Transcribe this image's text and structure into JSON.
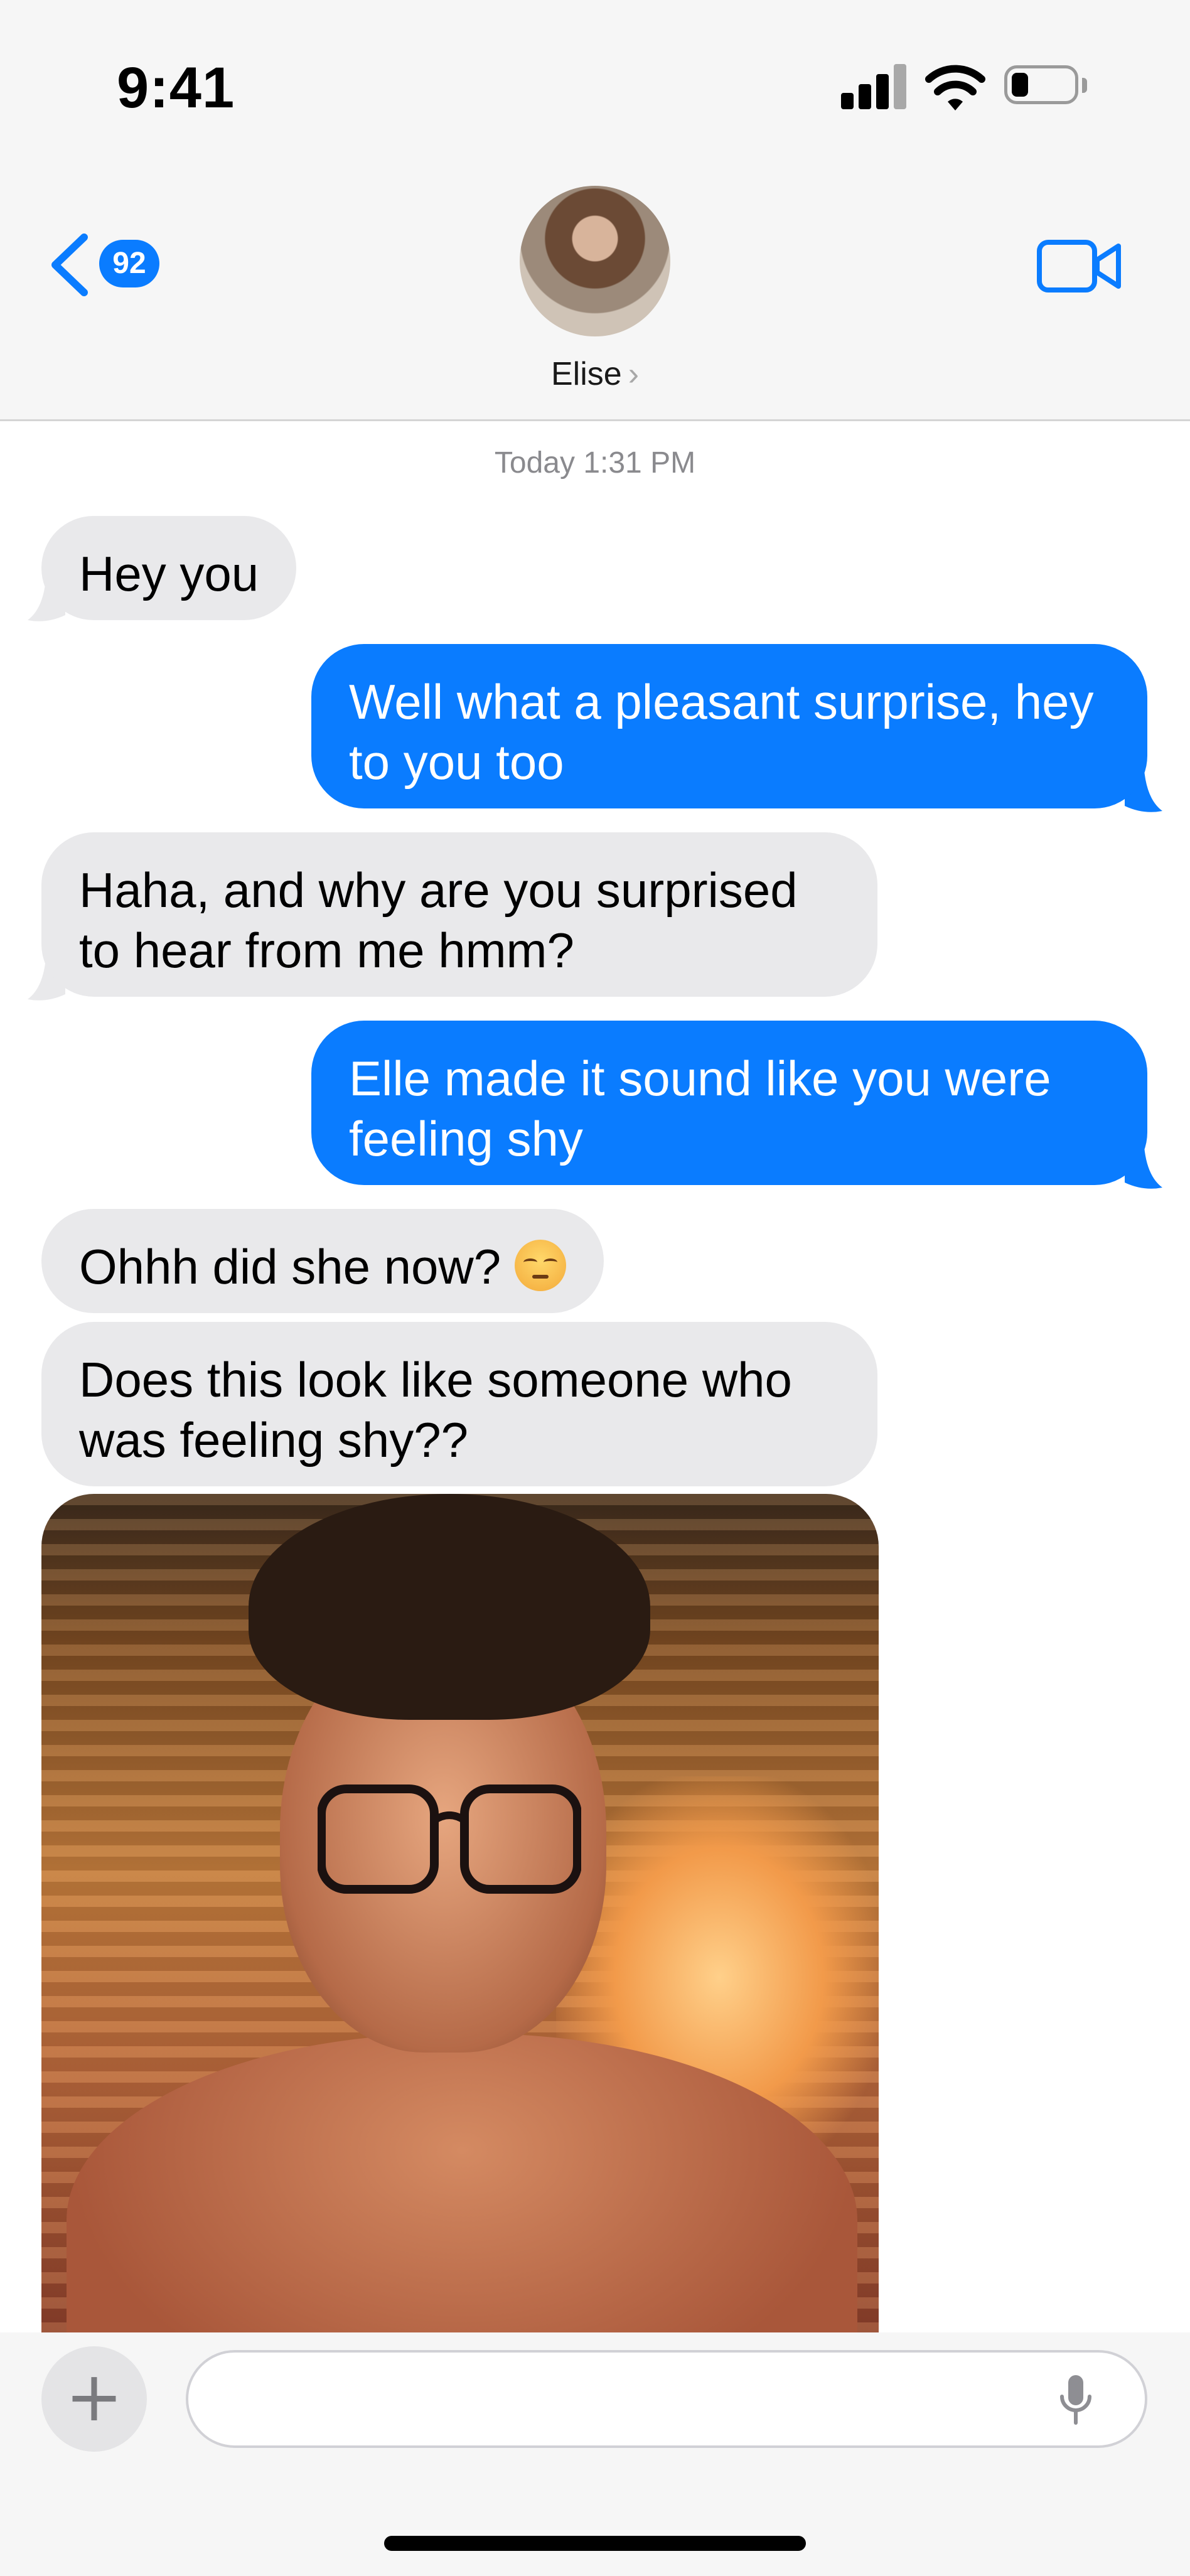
{
  "status_bar": {
    "time": "9:41",
    "signal_icon": "cellular-signal-icon",
    "wifi_icon": "wifi-icon",
    "battery_icon": "battery-icon"
  },
  "header": {
    "back_badge": "92",
    "contact_name": "Elise",
    "contact_chevron": "›",
    "video_icon": "video-camera-icon",
    "accent_color": "#0a7cff"
  },
  "chat": {
    "timestamp": "Today 1:31 PM",
    "messages": [
      {
        "from": "contact",
        "text": "Hey you"
      },
      {
        "from": "me",
        "text": "Well what a pleasant surprise, hey to you too"
      },
      {
        "from": "contact",
        "text": "Haha, and why are you surprised to hear from me hmm?"
      },
      {
        "from": "me",
        "text": "Elle made it sound like you were feeling shy"
      },
      {
        "from": "contact",
        "text": "Ohhh did she now?",
        "emoji": "relieved-smirk-emoji"
      },
      {
        "from": "contact",
        "text": "Does this look like someone who was feeling shy??"
      },
      {
        "from": "contact",
        "attachment": "photo"
      }
    ],
    "bubble_colors": {
      "received": "#e9e9eb",
      "sent": "#0a7cff"
    }
  },
  "composer": {
    "placeholder": "",
    "plus_label": "+",
    "mic_icon": "microphone-icon"
  }
}
